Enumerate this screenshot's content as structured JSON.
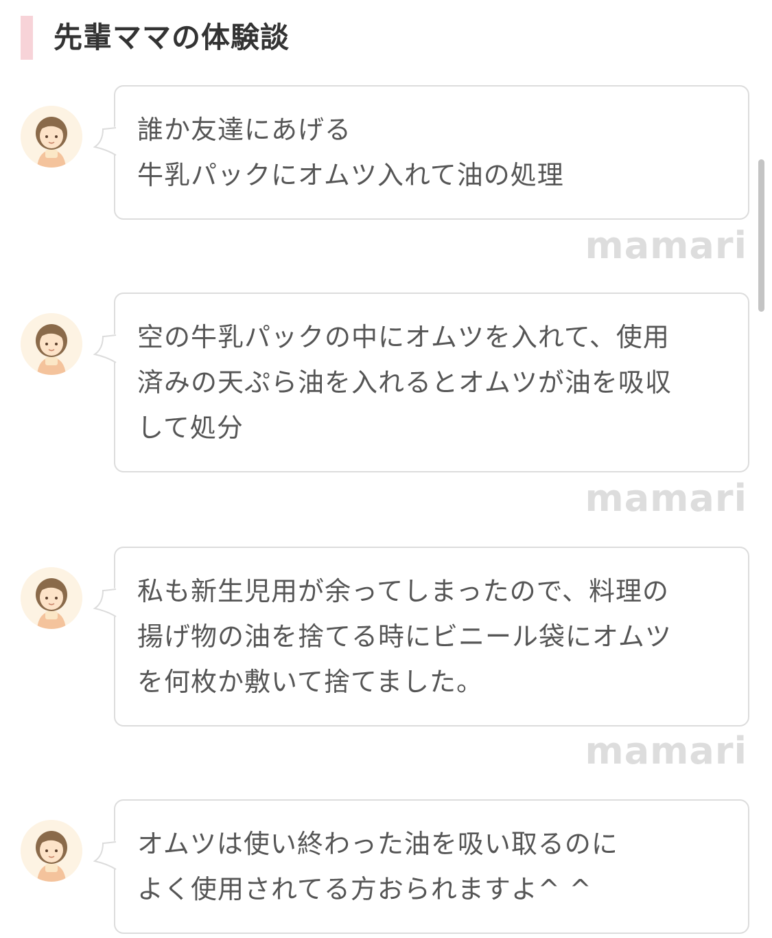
{
  "header": {
    "title": "先輩ママの体験談"
  },
  "comments": [
    {
      "avatar_icon": "mom-avatar-icon",
      "text": "誰か友達にあげる\n牛乳パックにオムツ入れて油の処理",
      "watermark": "mamari"
    },
    {
      "avatar_icon": "mom-avatar-icon",
      "text": "空の牛乳パックの中にオムツを入れて、使用\n済みの天ぷら油を入れるとオムツが油を吸収\nして処分",
      "watermark": "mamari"
    },
    {
      "avatar_icon": "mom-avatar-icon",
      "text": "私も新生児用が余ってしまったので、料理の\n揚げ物の油を捨てる時にビニール袋にオムツ\nを何枚か敷いて捨てました。",
      "watermark": "mamari"
    },
    {
      "avatar_icon": "mom-avatar-icon",
      "text": "オムツは使い終わった油を吸い取るのに\nよく使用されてる方おられますよ^ ^"
    }
  ],
  "colors": {
    "header_accent": "#f7d3d8",
    "bubble_border": "#dcdcdc",
    "watermark": "#dddddd",
    "avatar_bg": "#fdf3e3"
  }
}
